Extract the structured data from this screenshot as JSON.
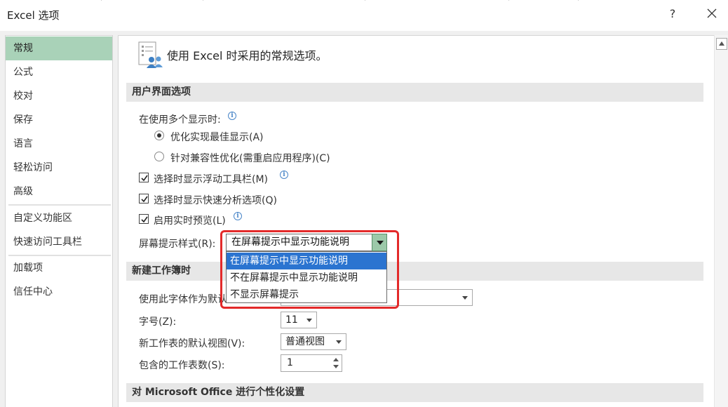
{
  "window": {
    "title": "Excel 选项",
    "help_label": "?"
  },
  "sidebar": {
    "items": [
      {
        "label": "常规",
        "active": true
      },
      {
        "label": "公式"
      },
      {
        "label": "校对"
      },
      {
        "label": "保存"
      },
      {
        "label": "语言"
      },
      {
        "label": "轻松访问"
      },
      {
        "label": "高级"
      },
      {
        "label": "自定义功能区"
      },
      {
        "label": "快速访问工具栏"
      },
      {
        "label": "加载项"
      },
      {
        "label": "信任中心"
      }
    ]
  },
  "main": {
    "header_text": "使用 Excel 时采用的常规选项。",
    "ui_section": {
      "title": "用户界面选项",
      "multi_display_label": "在使用多个显示时:",
      "radio_optimize": "优化实现最佳显示(A)",
      "radio_compat": "针对兼容性优化(需重启应用程序)(C)",
      "check_mini_toolbar": "选择时显示浮动工具栏(M)",
      "check_quick_analysis": "选择时显示快速分析选项(Q)",
      "check_live_preview": "启用实时预览(L)",
      "screentip_label": "屏幕提示样式(R):",
      "screentip_value": "在屏幕提示中显示功能说明",
      "screentip_options": [
        "在屏幕提示中显示功能说明",
        "不在屏幕提示中显示功能说明",
        "不显示屏幕提示"
      ]
    },
    "workbook_section": {
      "title": "新建工作簿时",
      "font_label": "使用此字体作为默认",
      "font_size_label": "字号(Z):",
      "font_size_value": "11",
      "default_view_label": "新工作表的默认视图(V):",
      "default_view_value": "普通视图",
      "sheet_count_label": "包含的工作表数(S):",
      "sheet_count_value": "1"
    },
    "personalize_section": {
      "title": "对 Microsoft Office 进行个性化设置"
    }
  },
  "colors": {
    "active_nav": "#a9d2b8",
    "dropdown_selected": "#2b74d0",
    "highlight_border": "#e32a2a",
    "combo_arrow": "#9cc9a9"
  }
}
